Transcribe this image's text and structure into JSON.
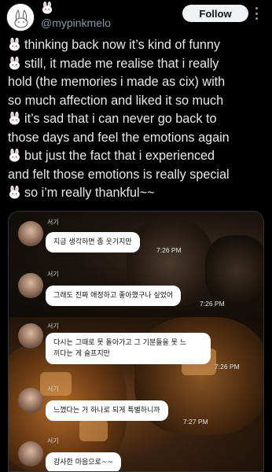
{
  "header": {
    "handle": "@mypinkmelo",
    "follow_label": "Follow"
  },
  "tweet": {
    "lines": [
      "thinking back now it’s kind of funny",
      "still, it made me realise that i really",
      "hold (the memories i made as cix) with",
      "so much affection and liked it so much",
      "it’s sad that i can never go back to",
      "those days and feel the emotions again",
      "but just the fact that i experienced",
      "and felt those emotions is really special",
      "so i’m really thankful~~"
    ],
    "bunny_lines": [
      0,
      1,
      4,
      6,
      8
    ]
  },
  "chat": {
    "sender": "서기",
    "messages": [
      {
        "text": "지금 생각하면 좀 웃기지만",
        "time": "7:26 PM"
      },
      {
        "text": "그래도 진짜 애정하고 좋아했구나 싶었어",
        "time": "7:26 PM"
      },
      {
        "text_line1": "다시는 그때로 못 돌아가고 그 기분들을 못 느",
        "text_line2": "끼다는 게 슬프지만",
        "time": "7:26 PM"
      },
      {
        "text": "느꼈다는 거 하나로 되게 특별하니까",
        "time": "7:27 PM"
      },
      {
        "text": "감사한 마음으로~~",
        "time": ""
      }
    ]
  },
  "colors": {
    "background": "#000000",
    "text": "#e7e9ea",
    "muted": "#8b98a5",
    "bunny_body": "#ffffff",
    "bunny_ear": "#f4a6c4",
    "follow_bg": "#eff3f4"
  }
}
